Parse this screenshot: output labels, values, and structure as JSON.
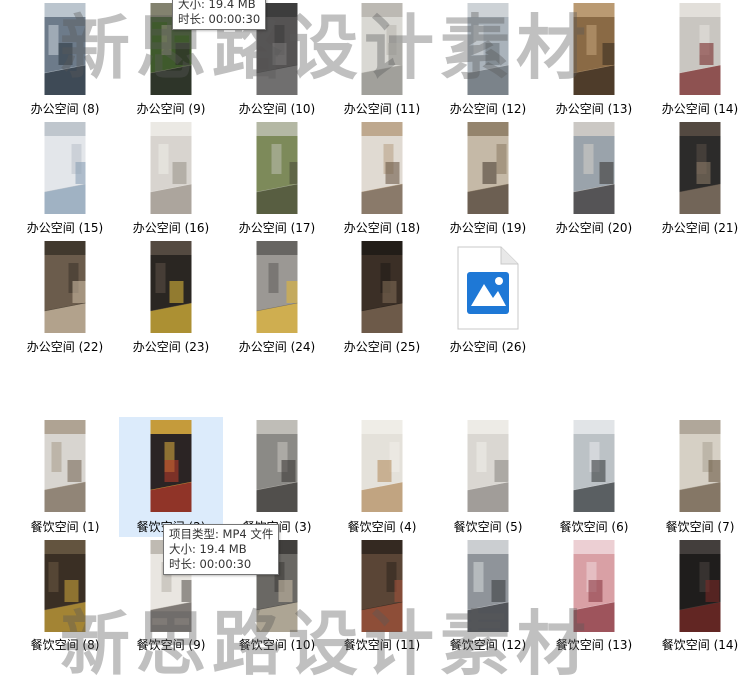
{
  "watermark_text": "新思路设计素材",
  "groups": [
    {
      "name": "office",
      "items": [
        {
          "label": "办公空间 (8)",
          "palette": [
            "#6d7b8a",
            "#2f3a44",
            "#c9d2d9"
          ]
        },
        {
          "label": "办公空间 (9)",
          "palette": [
            "#3f5a2c",
            "#2a2a28",
            "#8f8a7b"
          ]
        },
        {
          "label": "办公空间 (10)",
          "palette": [
            "#555353",
            "#7a7878",
            "#3a3a3a"
          ]
        },
        {
          "label": "办公空间 (11)",
          "palette": [
            "#d9d8d3",
            "#8e8d88",
            "#b6b4ad"
          ]
        },
        {
          "label": "办公空间 (12)",
          "palette": [
            "#aab3bb",
            "#6b737a",
            "#d3d7da"
          ]
        },
        {
          "label": "办公空间 (13)",
          "palette": [
            "#8a6a45",
            "#3a2e22",
            "#c2a27a"
          ]
        },
        {
          "label": "办公空间 (14)",
          "palette": [
            "#c9c6c1",
            "#7a2b2b",
            "#e6e3de"
          ]
        },
        {
          "label": "办公空间 (15)",
          "palette": [
            "#e3e6ea",
            "#8aa0b5",
            "#b9c0c8"
          ]
        },
        {
          "label": "办公空间 (16)",
          "palette": [
            "#d8d4cf",
            "#9d968c",
            "#efece8"
          ]
        },
        {
          "label": "办公空间 (17)",
          "palette": [
            "#7d8a5a",
            "#4c4f3a",
            "#bdbfb2"
          ]
        },
        {
          "label": "办公空间 (18)",
          "palette": [
            "#e0dad2",
            "#6d5a47",
            "#b79f82"
          ]
        },
        {
          "label": "办公空间 (19)",
          "palette": [
            "#c5b9a7",
            "#4d4136",
            "#8b7a63"
          ]
        },
        {
          "label": "办公空间 (20)",
          "palette": [
            "#9aa3ab",
            "#3e3a39",
            "#d4cfc8"
          ]
        },
        {
          "label": "办公空间 (21)",
          "palette": [
            "#2c2b2a",
            "#8a7a68",
            "#5a4f45"
          ]
        },
        {
          "label": "办公空间 (22)",
          "palette": [
            "#6b5c4c",
            "#c9b9a2",
            "#3a3329"
          ]
        },
        {
          "label": "办公空间 (23)",
          "palette": [
            "#2a2622",
            "#d8b43a",
            "#5c5147"
          ]
        },
        {
          "label": "办公空间 (24)",
          "palette": [
            "#9b9894",
            "#e0b63a",
            "#5e5c59"
          ]
        },
        {
          "label": "办公空间 (25)",
          "palette": [
            "#3b2f26",
            "#7f6a55",
            "#1f1a16"
          ]
        },
        {
          "label": "办公空间 (26)",
          "palette": []
        }
      ]
    },
    {
      "name": "dining",
      "items": [
        {
          "label": "餐饮空间 (1)",
          "palette": [
            "#d8d5d0",
            "#7a6a5a",
            "#a89a88"
          ]
        },
        {
          "label": "餐饮空间 (2)",
          "palette": [
            "#2b2424",
            "#b33a2a",
            "#e0b040"
          ]
        },
        {
          "label": "餐饮空间 (3)",
          "palette": [
            "#8b8a86",
            "#3d3b38",
            "#c8c5bf"
          ]
        },
        {
          "label": "餐饮空间 (4)",
          "palette": [
            "#e4e1da",
            "#b58f63",
            "#f1eee9"
          ]
        },
        {
          "label": "餐饮空间 (5)",
          "palette": [
            "#dad7d2",
            "#8d8a85",
            "#f0eeea"
          ]
        },
        {
          "label": "餐饮空间 (6)",
          "palette": [
            "#bcc2c6",
            "#3a3d40",
            "#e8eaec"
          ]
        },
        {
          "label": "餐饮空间 (7)",
          "palette": [
            "#d6d0c5",
            "#6a5a45",
            "#a9a092"
          ]
        },
        {
          "label": "餐饮空间 (8)",
          "palette": [
            "#3a2f24",
            "#c7a23a",
            "#6b5a44"
          ]
        },
        {
          "label": "餐饮空间 (9)",
          "palette": [
            "#e9e6e1",
            "#5b5652",
            "#b7b1a9"
          ]
        },
        {
          "label": "餐饮空间 (10)",
          "palette": [
            "#6a6864",
            "#c4b9a4",
            "#3a3836"
          ]
        },
        {
          "label": "餐饮空间 (11)",
          "palette": [
            "#5a4536",
            "#a0523a",
            "#2e241d"
          ]
        },
        {
          "label": "餐饮空间 (12)",
          "palette": [
            "#8f949a",
            "#3c3f43",
            "#d6d8db"
          ]
        },
        {
          "label": "餐饮空间 (13)",
          "palette": [
            "#d9a0a5",
            "#8a3b44",
            "#efd7da"
          ]
        },
        {
          "label": "餐饮空间 (14)",
          "palette": [
            "#1f1d1c",
            "#7a2a26",
            "#4a4442"
          ]
        }
      ]
    }
  ],
  "tooltips": [
    {
      "type_line": "",
      "size_line": "大小: 19.4 MB",
      "duration_line": "时长: 00:00:30"
    },
    {
      "type_line": "项目类型: MP4 文件",
      "size_line": "大小: 19.4 MB",
      "duration_line": "时长: 00:00:30"
    }
  ]
}
